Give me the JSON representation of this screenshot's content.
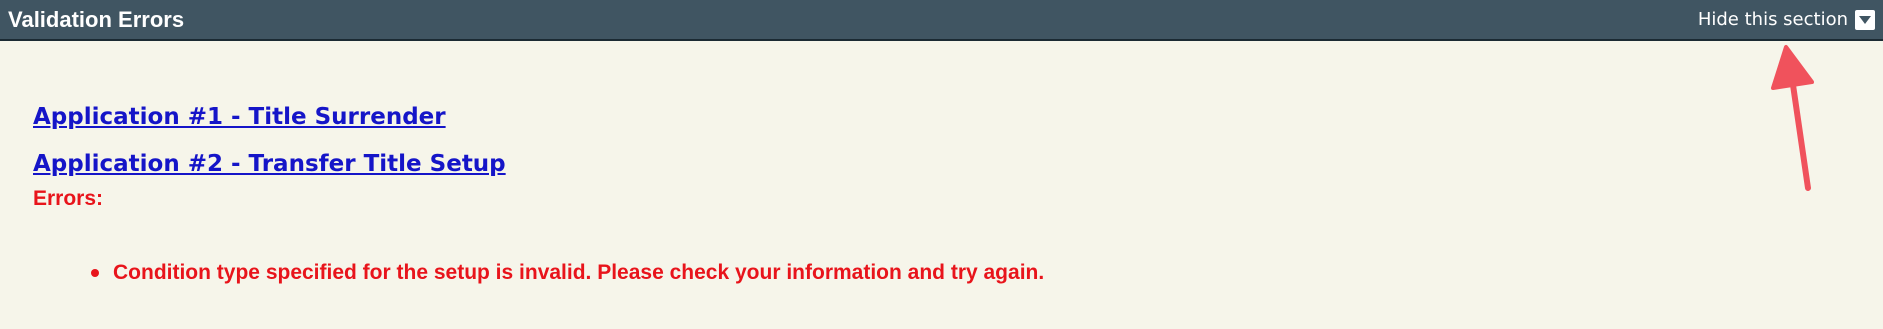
{
  "header": {
    "title": "Validation Errors",
    "hide_label": "Hide this section",
    "hide_icon": "triangle-down-icon"
  },
  "applications": [
    {
      "label": "Application #1 - Title Surrender"
    },
    {
      "label": "Application #2 - Transfer Title Setup"
    }
  ],
  "errors": {
    "label": "Errors:",
    "items": [
      "Condition type specified for the setup is invalid. Please check your information and try again."
    ]
  },
  "colors": {
    "header_bg": "#405562",
    "page_bg": "#f6f5ea",
    "link": "#1515c8",
    "error": "#e8141b",
    "annotation_arrow": "#f0525c"
  }
}
